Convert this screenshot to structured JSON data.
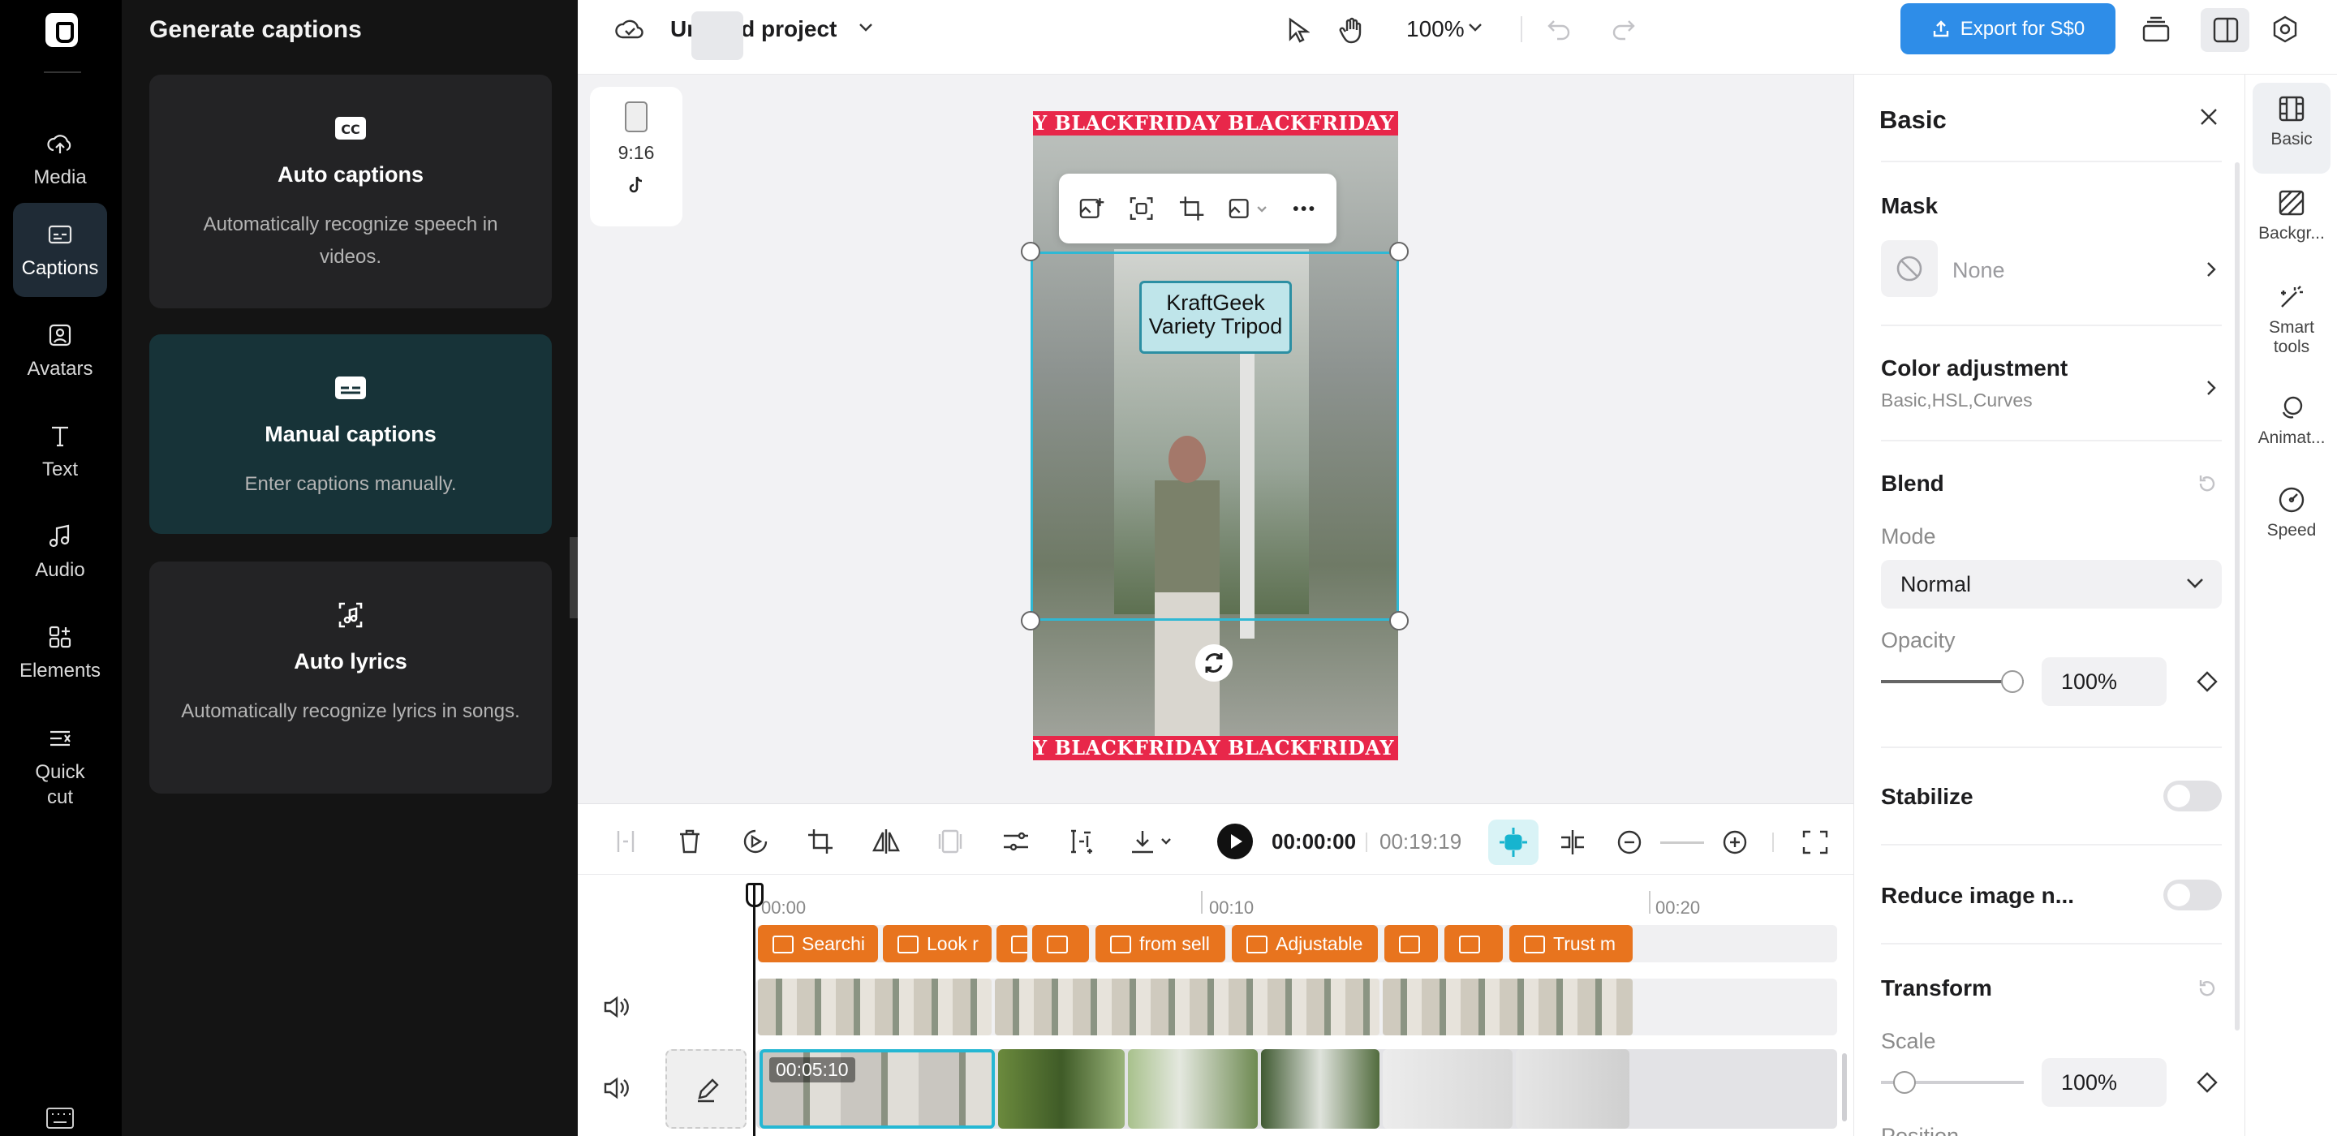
{
  "rail": {
    "items": [
      {
        "label": "Media",
        "icon": "cloud-upload-icon"
      },
      {
        "label": "Captions",
        "icon": "captions-icon"
      },
      {
        "label": "Avatars",
        "icon": "avatar-icon"
      },
      {
        "label": "Text",
        "icon": "text-icon"
      },
      {
        "label": "Audio",
        "icon": "music-icon"
      },
      {
        "label": "Elements",
        "icon": "elements-icon"
      },
      {
        "label": "Quick cut",
        "icon": "quick-cut-icon"
      }
    ],
    "active": "Captions"
  },
  "panel": {
    "title": "Generate captions",
    "cards": [
      {
        "title": "Auto captions",
        "desc": "Automatically recognize speech in videos."
      },
      {
        "title": "Manual captions",
        "desc": "Enter captions manually."
      },
      {
        "title": "Auto lyrics",
        "desc": "Automatically recognize lyrics in songs."
      }
    ]
  },
  "topbar": {
    "project_name": "Untitled project",
    "zoom": "100%",
    "export_label": "Export for S$0"
  },
  "canvas": {
    "ratio": "9:16",
    "banner_text": "Y BLACKFRIDAY BLACKFRIDAY BLACKFRIDAY B",
    "title_line1": "KraftGeek",
    "title_line2": "Variety Tripod"
  },
  "timeline": {
    "current_time": "00:00:00",
    "total_time": "00:19:19",
    "ruler": [
      "00:00",
      "00:10",
      "00:20"
    ],
    "caption_chips": [
      "Searchi",
      "Look r",
      "",
      "",
      "from sell",
      "Adjustable",
      "",
      "",
      "Trust m"
    ],
    "selected_clip_time": "00:05:10"
  },
  "rpanel": {
    "title": "Basic",
    "mask_label": "Mask",
    "mask_value": "None",
    "color_adj": "Color adjustment",
    "color_adj_sub": "Basic,HSL,Curves",
    "blend": "Blend",
    "mode_label": "Mode",
    "mode_value": "Normal",
    "opacity_label": "Opacity",
    "opacity_value": "100%",
    "opacity_level": 1.0,
    "stabilize": "Stabilize",
    "reduce_noise": "Reduce image n...",
    "transform": "Transform",
    "scale_label": "Scale",
    "scale_value": "100%",
    "scale_level": 0.1,
    "position_label": "Position"
  },
  "rtabs": [
    {
      "label": "Basic",
      "icon": "film-icon"
    },
    {
      "label": "Backgr...",
      "icon": "background-icon"
    },
    {
      "label": "Smart tools",
      "icon": "magic-wand-icon"
    },
    {
      "label": "Animat...",
      "icon": "animation-icon"
    },
    {
      "label": "Speed",
      "icon": "speed-icon"
    }
  ],
  "colors": {
    "accent": "#2e8de8",
    "caption_chip": "#e8741e",
    "selection": "#2fb8d4"
  }
}
